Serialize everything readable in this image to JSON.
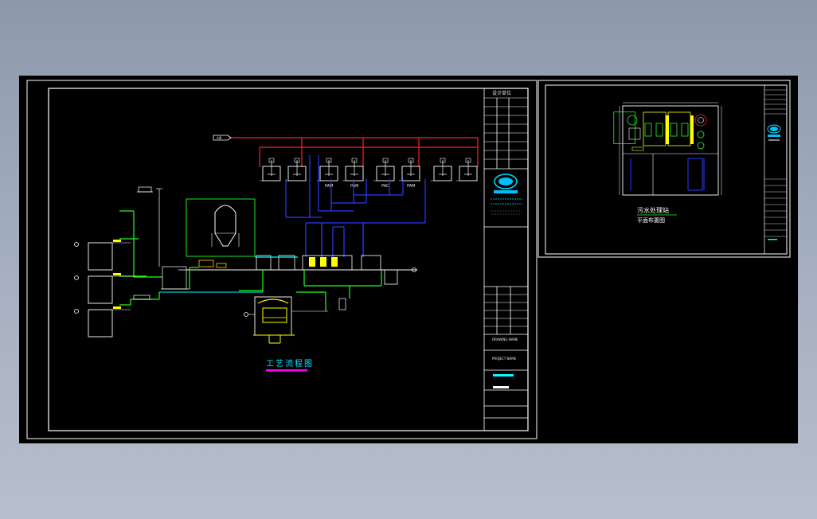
{
  "window": {
    "background_gradient": [
      "#8d99ab",
      "#b7bfcc"
    ],
    "canvas_color": "#000000"
  },
  "colors": {
    "red": "#ff2020",
    "blue": "#2a3bff",
    "green": "#20ff20",
    "white": "#ffffff",
    "yellow": "#ffff00",
    "magenta": "#ff00ff",
    "cyan": "#00ffff"
  },
  "sheet1": {
    "title": "工艺流程图",
    "tank_labels": [
      "PAM",
      "PAM",
      "PAC",
      "PAM"
    ],
    "inlet_tag": "AIR",
    "titleblock": {
      "header": "设计单位",
      "drawing_no": "DRAWING NAME",
      "project": "PROJECT NAME"
    }
  },
  "sheet2": {
    "title": "污水处理站",
    "subtitle": "平面布置图"
  }
}
